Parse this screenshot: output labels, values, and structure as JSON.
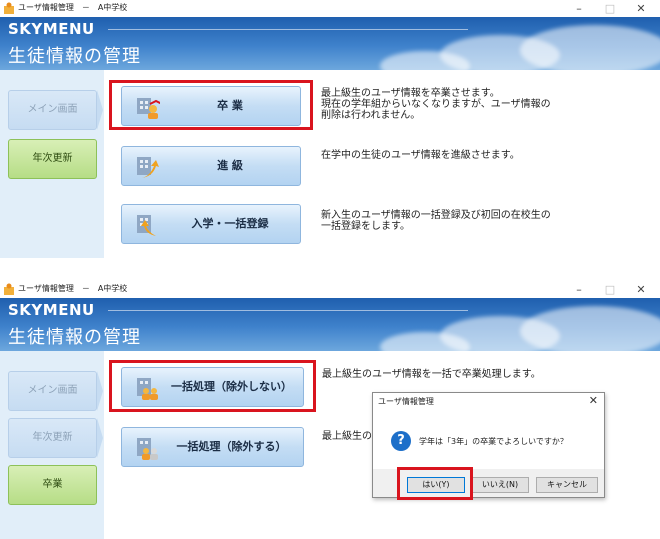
{
  "window": {
    "title": "ユーザ情報管理　－　A中学校",
    "minimize": "–",
    "maximize": "□",
    "close": "✕"
  },
  "header": {
    "brand": "SKYMENU",
    "page_title": "生徒情報の管理"
  },
  "screen1": {
    "sidebar": [
      {
        "label": "メイン画面",
        "state": "inactive"
      },
      {
        "label": "年次更新",
        "state": "active"
      }
    ],
    "actions": [
      {
        "label": "卒 業",
        "icon": "graduation-icon",
        "description": "最上級生のユーザ情報を卒業させます。\n現在の学年組からいなくなりますが、ユーザ情報の\n削除は行われません。",
        "highlighted": true
      },
      {
        "label": "進 級",
        "icon": "promotion-icon",
        "description": "在学中の生徒のユーザ情報を進級させます。",
        "highlighted": false
      },
      {
        "label": "入学・一括登録",
        "icon": "enrollment-icon",
        "description": "新入生のユーザ情報の一括登録及び初回の在校生の\n一括登録をします。",
        "highlighted": false
      }
    ]
  },
  "screen2": {
    "sidebar": [
      {
        "label": "メイン画面",
        "state": "inactive"
      },
      {
        "label": "年次更新",
        "state": "inactive"
      },
      {
        "label": "卒業",
        "state": "active"
      }
    ],
    "actions": [
      {
        "label": "一括処理（除外しない）",
        "icon": "batch-process-icon",
        "description": "最上級生のユーザ情報を一括で卒業処理します。",
        "highlighted": true
      },
      {
        "label": "一括処理（除外する）",
        "icon": "batch-exclude-icon",
        "description": "最上級生の",
        "highlighted": false
      }
    ]
  },
  "dialog": {
    "title": "ユーザ情報管理",
    "close": "✕",
    "message": "学年は「3年」の卒業でよろしいですか？",
    "buttons": {
      "yes": "はい(Y)",
      "no": "いいえ(N)",
      "cancel": "キャンセル"
    }
  },
  "colors": {
    "highlight": "#d9141e",
    "header_blue": "#2f73c2",
    "active_green": "#b6dd86"
  }
}
